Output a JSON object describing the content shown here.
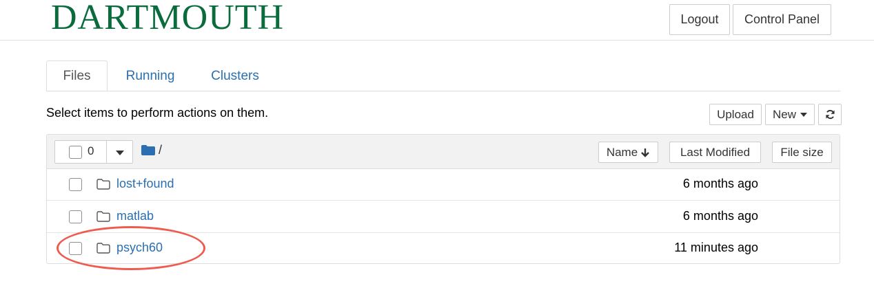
{
  "header": {
    "logo_text": "DARTMOUTH",
    "logout_label": "Logout",
    "control_panel_label": "Control Panel"
  },
  "tabs": [
    {
      "label": "Files",
      "active": true
    },
    {
      "label": "Running",
      "active": false
    },
    {
      "label": "Clusters",
      "active": false
    }
  ],
  "toolbar": {
    "instructions": "Select items to perform actions on them.",
    "upload_label": "Upload",
    "new_label": "New",
    "refresh_icon": "refresh-icon"
  },
  "list_header": {
    "selected_count": "0",
    "path": "/",
    "sort_name_label": "Name",
    "sort_modified_label": "Last Modified",
    "sort_size_label": "File size"
  },
  "files": [
    {
      "name": "lost+found",
      "modified": "6 months ago",
      "icon": "folder-icon"
    },
    {
      "name": "matlab",
      "modified": "6 months ago",
      "icon": "folder-icon"
    },
    {
      "name": "psych60",
      "modified": "11 minutes ago",
      "icon": "folder-icon"
    }
  ],
  "colors": {
    "brand_green": "#0a6b3c",
    "link_blue": "#2a6fb0",
    "highlight_red": "#ee5c50"
  }
}
